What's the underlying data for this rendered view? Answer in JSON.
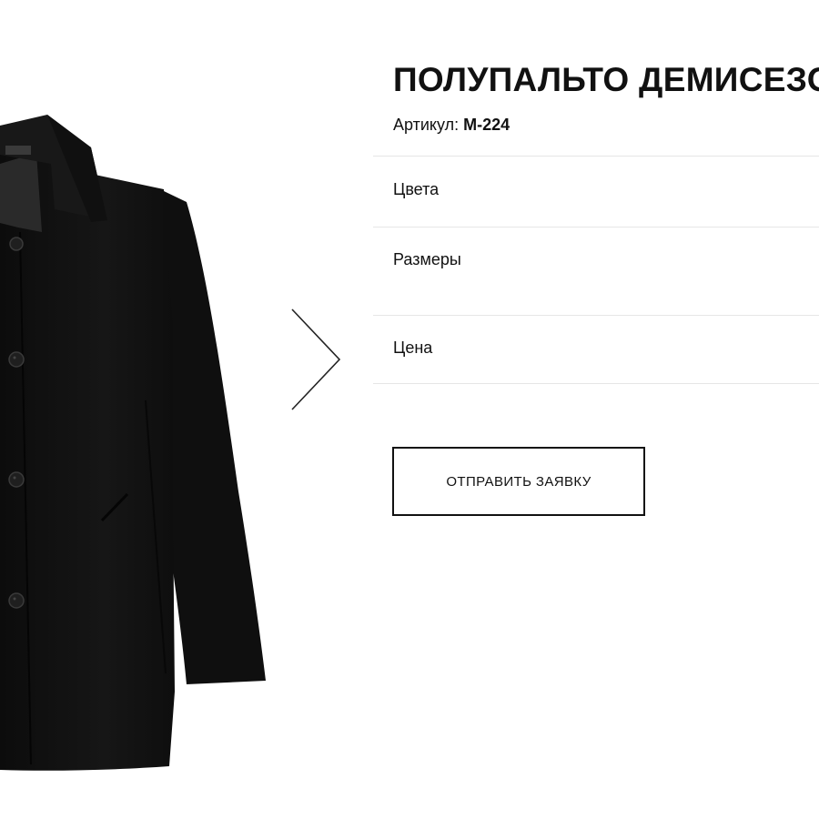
{
  "product": {
    "title": "ПОЛУПАЛЬТО ДЕМИСЕЗОННОЕ",
    "sku_label": "Артикул: ",
    "sku_value": "М-224"
  },
  "options": {
    "colors_label": "Цвета",
    "sizes_label": "Размеры",
    "price_label": "Цена"
  },
  "actions": {
    "order_label": "ОТПРАВИТЬ ЗАЯВКУ"
  },
  "gallery": {
    "image_icon": "coat-photo",
    "next_icon": "chevron-right-icon"
  },
  "colors": {
    "coat": "#121212",
    "text": "#111111",
    "divider": "#e6e6e6",
    "arrow": "#222222"
  }
}
